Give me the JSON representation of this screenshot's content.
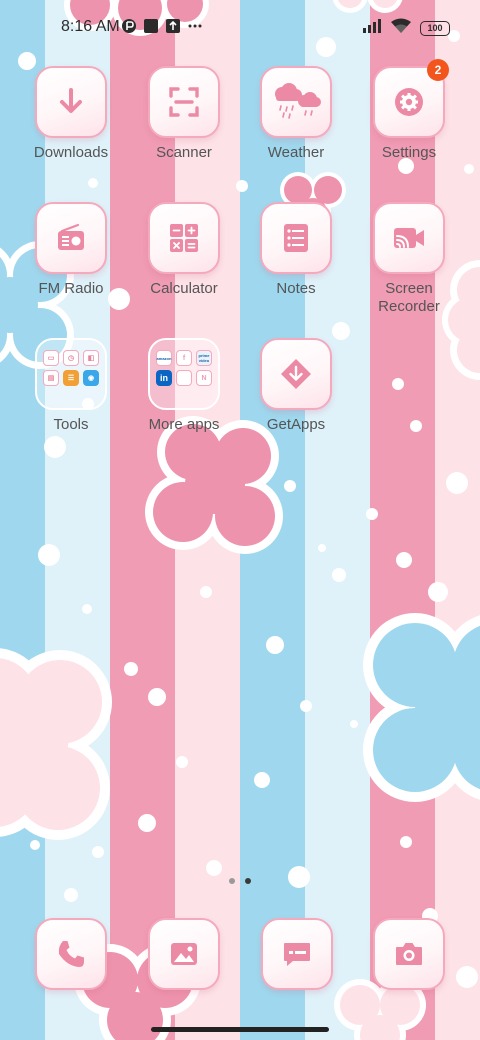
{
  "status_bar": {
    "time": "8:16 AM",
    "battery": "100",
    "icons_left": [
      "data-saver-icon",
      "square-notification-icon",
      "upload-icon",
      "more-dots-icon"
    ],
    "icons_right": [
      "signal-icon",
      "wifi-icon",
      "battery-icon"
    ]
  },
  "apps": [
    {
      "label": "Downloads",
      "icon": "download-arrow-icon"
    },
    {
      "label": "Scanner",
      "icon": "scan-frame-icon"
    },
    {
      "label": "Weather",
      "icon": "weather-cloud-icon"
    },
    {
      "label": "Settings",
      "icon": "gear-icon",
      "badge": "2"
    },
    {
      "label": "FM Radio",
      "icon": "radio-icon"
    },
    {
      "label": "Calculator",
      "icon": "calculator-icon"
    },
    {
      "label": "Notes",
      "icon": "notes-list-icon"
    },
    {
      "label": "Screen Recorder",
      "icon": "cast-record-icon"
    },
    {
      "label": "Tools",
      "icon": "folder-icon"
    },
    {
      "label": "More apps",
      "icon": "folder-icon",
      "mini_labels": [
        "amazon",
        "f",
        "prime video",
        "in",
        "",
        "N"
      ]
    },
    {
      "label": "GetApps",
      "icon": "getapps-diamond-icon"
    }
  ],
  "dock": [
    {
      "name": "phone",
      "icon": "phone-icon"
    },
    {
      "name": "gallery",
      "icon": "gallery-image-icon"
    },
    {
      "name": "messages",
      "icon": "message-icon"
    },
    {
      "name": "camera",
      "icon": "camera-icon"
    }
  ],
  "pages": {
    "count": 2,
    "active": 2
  },
  "colors": {
    "icon_pink": "#ec8aa6",
    "stripe_blue": "#9fd8ee",
    "stripe_pale_blue": "#dff1f9",
    "stripe_pink": "#f09cb4",
    "stripe_pale_pink": "#fde2e8",
    "badge": "#f2561d"
  }
}
